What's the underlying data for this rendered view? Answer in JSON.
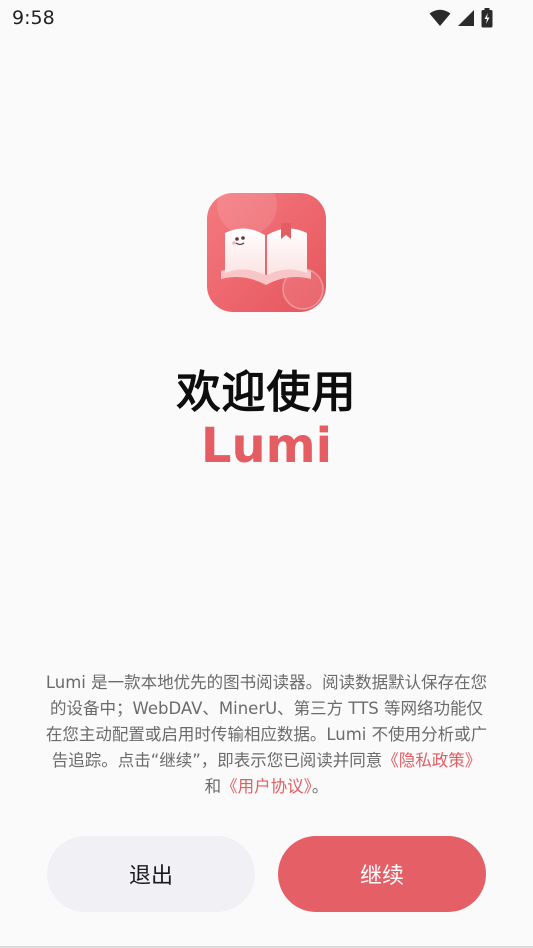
{
  "status_bar": {
    "time": "9:58",
    "icons": [
      "wifi-icon",
      "signal-icon",
      "battery-icon"
    ]
  },
  "logo": {
    "icon": "open-book-icon",
    "colors": {
      "primary": "#e35d63",
      "light": "#f7a9ab"
    }
  },
  "welcome": {
    "title": "欢迎使用",
    "app_name": "Lumi"
  },
  "privacy": {
    "text_main": "Lumi 是一款本地优先的图书阅读器。阅读数据默认保存在您的设备中；WebDAV、MinerU、第三方 TTS 等网络功能仅在您主动配置或启用时传输相应数据。Lumi 不使用分析或广告追踪。点击“继续”，即表示您已阅读并同意",
    "privacy_policy_link": "《隐私政策》",
    "conjunction": "和",
    "user_agreement_link": "《用户协议》",
    "ending": "。"
  },
  "buttons": {
    "exit_label": "退出",
    "continue_label": "继续"
  },
  "colors": {
    "accent": "#e35d63",
    "background": "#fbfafb",
    "secondary_button": "#f1f0f5"
  }
}
